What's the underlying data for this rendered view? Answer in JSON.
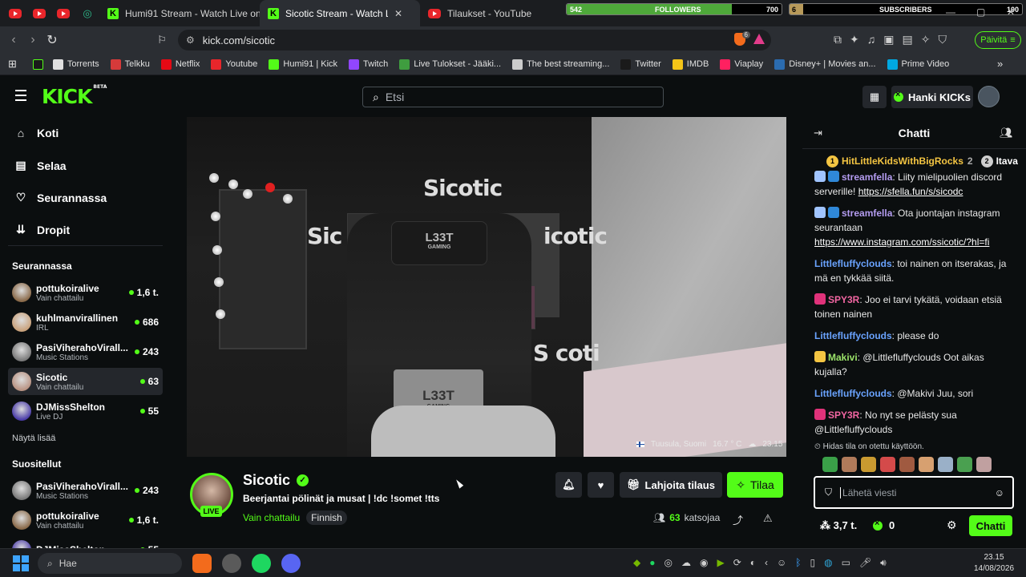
{
  "browser": {
    "tabs": [
      {
        "title": "Humi91 Stream - Watch Live on Kick",
        "active": false
      },
      {
        "title": "Sicotic Stream - Watch Live on Kick",
        "active": true
      },
      {
        "title": "Tilaukset - YouTube",
        "active": false
      }
    ],
    "followers_counter": {
      "label": "FOLLOWERS",
      "current": "542",
      "goal": "700",
      "progress": 0.77
    },
    "subscribers_counter": {
      "label": "SUBSCRIBERS",
      "current": "6",
      "goal": "100",
      "progress": 0.06
    },
    "url": "kick.com/sicotic",
    "brave_badge": "6",
    "update_button": "Päivitä",
    "bookmarks": [
      {
        "label": "Torrents",
        "color": "#e0e0e0"
      },
      {
        "label": "Telkku",
        "color": "#d63a3a"
      },
      {
        "label": "Netflix",
        "color": "#e50914"
      },
      {
        "label": "Youtube",
        "color": "#e9262b"
      },
      {
        "label": "Humi91 | Kick",
        "color": "#53fc18"
      },
      {
        "label": "Twitch",
        "color": "#9146ff"
      },
      {
        "label": "Live Tulokset - Jääki...",
        "color": "#3f9d3f"
      },
      {
        "label": "The best streaming...",
        "color": "#cccccc"
      },
      {
        "label": "Twitter",
        "color": "#1a1a1a"
      },
      {
        "label": "IMDB",
        "color": "#f5c518"
      },
      {
        "label": "Viaplay",
        "color": "#ff2060"
      },
      {
        "label": "Disney+ | Movies an...",
        "color": "#2b6cb0"
      },
      {
        "label": "Prime Video",
        "color": "#00a8e1"
      }
    ]
  },
  "kick": {
    "logo_text": "KICK",
    "logo_badge": "BETA",
    "search_placeholder": "Etsi",
    "kicks_button": "Hanki KICKs",
    "accent": "#53fc18"
  },
  "sidebar": {
    "nav": [
      {
        "label": "Koti",
        "icon": "home-icon"
      },
      {
        "label": "Selaa",
        "icon": "browse-icon"
      },
      {
        "label": "Seurannassa",
        "icon": "heart-icon"
      },
      {
        "label": "Dropit",
        "icon": "drops-icon"
      }
    ],
    "following_heading": "Seurannassa",
    "following": [
      {
        "name": "pottukoiralive",
        "category": "Vain chattailu",
        "viewers": "1,6 t.",
        "color": "#8a6a4a",
        "selected": false
      },
      {
        "name": "kuhlmanvirallinen",
        "category": "IRL",
        "viewers": "686",
        "color": "#c9a27c",
        "selected": false
      },
      {
        "name": "PasiViherahoVirall...",
        "category": "Music Stations",
        "viewers": "243",
        "color": "#7a7a7a",
        "selected": false
      },
      {
        "name": "Sicotic",
        "category": "Vain chattailu",
        "viewers": "63",
        "color": "#b99383",
        "selected": true
      },
      {
        "name": "DJMissShelton",
        "category": "Live DJ",
        "viewers": "55",
        "color": "#4b3da8",
        "selected": false
      }
    ],
    "show_more": "Näytä lisää",
    "recommended_heading": "Suositellut",
    "recommended": [
      {
        "name": "PasiViherahoVirall...",
        "category": "Music Stations",
        "viewers": "243",
        "color": "#7a7a7a"
      },
      {
        "name": "pottukoiralive",
        "category": "Vain chattailu",
        "viewers": "1,6 t.",
        "color": "#8a6a4a"
      },
      {
        "name": "DJMissShelton",
        "category": "",
        "viewers": "55",
        "color": "#4b3da8"
      }
    ]
  },
  "video": {
    "wall_text_1": "Sicotic",
    "wall_text_2": "Sic",
    "wall_text_3": "icotic",
    "wall_text_4": "S coti",
    "chair_logo": "L33T",
    "chair_sublogo": "GAMING",
    "location": "Tuusula, Suomi",
    "temperature": "16.7 ° C",
    "time": "23.15"
  },
  "stream": {
    "name": "Sicotic",
    "live_label": "LIVE",
    "title": "Beerjantai pölinät ja musat | !dc !somet !tts",
    "category": "Vain chattailu",
    "tag": "Finnish",
    "gift_button": "Lahjoita tilaus",
    "subscribe_button": "Tilaa",
    "viewer_count": "63",
    "viewer_label": "katsojaa"
  },
  "chat": {
    "title": "Chatti",
    "gifters": [
      {
        "rank": "1",
        "name": "HitLittleKidsWithBigRocks",
        "count": "2",
        "color": "#f4c542"
      },
      {
        "rank": "2",
        "name": "Itava",
        "count": "",
        "color": "#cfcfcf"
      }
    ],
    "messages": [
      {
        "user": "streamfella",
        "color": "#b49cf0",
        "text": ": Liity mielipuolien discord serverille! ",
        "link": "https://sfella.fun/s/sicodc",
        "badges": [
          "#a0c4ff",
          "#2f88d8"
        ]
      },
      {
        "user": "streamfella",
        "color": "#b49cf0",
        "text": ": Ota juontajan instagram seurantaan ",
        "link": "https://www.instagram.com/ssicotic/?hl=fi",
        "badges": [
          "#a0c4ff",
          "#2f88d8"
        ]
      },
      {
        "user": "Littlefluffyclouds",
        "color": "#6aa3ff",
        "text": ": toi nainen on itserakas, ja mä en tykkää siitä.",
        "link": "",
        "badges": []
      },
      {
        "user": "SPY3R",
        "color": "#f266a2",
        "text": ": Joo ei tarvi tykätä, voidaan etsiä toinen nainen",
        "link": "",
        "badges": [
          "#e0327a"
        ]
      },
      {
        "user": "Littlefluffyclouds",
        "color": "#6aa3ff",
        "text": ": please do",
        "link": "",
        "badges": []
      },
      {
        "user": "Makivi",
        "color": "#9ce46a",
        "text": ": @Littlefluffyclouds Oot aikas kujalla?",
        "link": "",
        "badges": [
          "#f4c542"
        ]
      },
      {
        "user": "Littlefluffyclouds",
        "color": "#6aa3ff",
        "text": ": @Makivi Juu, sori",
        "link": "",
        "badges": []
      },
      {
        "user": "SPY3R",
        "color": "#f266a2",
        "text": ": No nyt se pelästy sua @Littlefluffyclouds",
        "link": "",
        "badges": [
          "#e0327a"
        ]
      }
    ],
    "slow_mode": "Hidas tila on otettu käyttöön.",
    "emote_colors": [
      "#3aa048",
      "#b07a5a",
      "#c99a30",
      "#d44a4a",
      "#a05a40",
      "#d7a070",
      "#9ab0c8",
      "#4aa050",
      "#c0a0a0"
    ],
    "input_placeholder": "Lähetä viesti",
    "kicks_balance": "3,7 t.",
    "kicks_points": "0",
    "send_button": "Chatti"
  },
  "taskbar": {
    "search_placeholder": "Hae",
    "date": "14/08/2026",
    "time": "23.15"
  }
}
